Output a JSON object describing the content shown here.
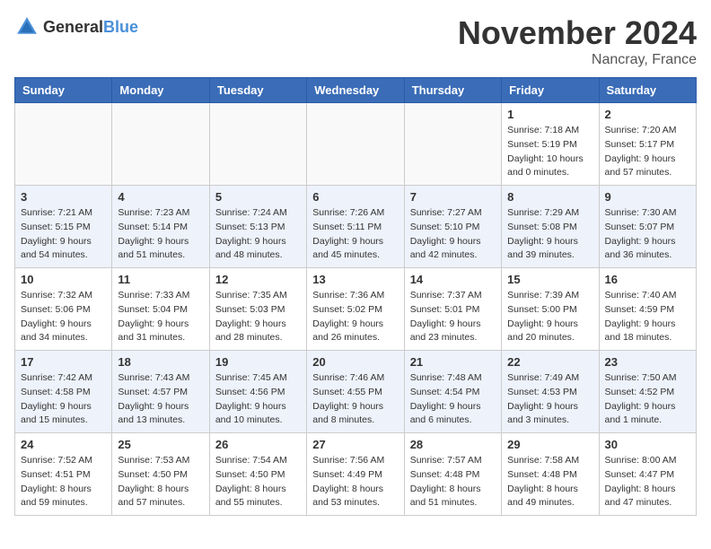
{
  "header": {
    "logo_general": "General",
    "logo_blue": "Blue",
    "month": "November 2024",
    "location": "Nancray, France"
  },
  "weekdays": [
    "Sunday",
    "Monday",
    "Tuesday",
    "Wednesday",
    "Thursday",
    "Friday",
    "Saturday"
  ],
  "weeks": [
    [
      {
        "day": "",
        "info": ""
      },
      {
        "day": "",
        "info": ""
      },
      {
        "day": "",
        "info": ""
      },
      {
        "day": "",
        "info": ""
      },
      {
        "day": "",
        "info": ""
      },
      {
        "day": "1",
        "info": "Sunrise: 7:18 AM\nSunset: 5:19 PM\nDaylight: 10 hours and 0 minutes."
      },
      {
        "day": "2",
        "info": "Sunrise: 7:20 AM\nSunset: 5:17 PM\nDaylight: 9 hours and 57 minutes."
      }
    ],
    [
      {
        "day": "3",
        "info": "Sunrise: 7:21 AM\nSunset: 5:15 PM\nDaylight: 9 hours and 54 minutes."
      },
      {
        "day": "4",
        "info": "Sunrise: 7:23 AM\nSunset: 5:14 PM\nDaylight: 9 hours and 51 minutes."
      },
      {
        "day": "5",
        "info": "Sunrise: 7:24 AM\nSunset: 5:13 PM\nDaylight: 9 hours and 48 minutes."
      },
      {
        "day": "6",
        "info": "Sunrise: 7:26 AM\nSunset: 5:11 PM\nDaylight: 9 hours and 45 minutes."
      },
      {
        "day": "7",
        "info": "Sunrise: 7:27 AM\nSunset: 5:10 PM\nDaylight: 9 hours and 42 minutes."
      },
      {
        "day": "8",
        "info": "Sunrise: 7:29 AM\nSunset: 5:08 PM\nDaylight: 9 hours and 39 minutes."
      },
      {
        "day": "9",
        "info": "Sunrise: 7:30 AM\nSunset: 5:07 PM\nDaylight: 9 hours and 36 minutes."
      }
    ],
    [
      {
        "day": "10",
        "info": "Sunrise: 7:32 AM\nSunset: 5:06 PM\nDaylight: 9 hours and 34 minutes."
      },
      {
        "day": "11",
        "info": "Sunrise: 7:33 AM\nSunset: 5:04 PM\nDaylight: 9 hours and 31 minutes."
      },
      {
        "day": "12",
        "info": "Sunrise: 7:35 AM\nSunset: 5:03 PM\nDaylight: 9 hours and 28 minutes."
      },
      {
        "day": "13",
        "info": "Sunrise: 7:36 AM\nSunset: 5:02 PM\nDaylight: 9 hours and 26 minutes."
      },
      {
        "day": "14",
        "info": "Sunrise: 7:37 AM\nSunset: 5:01 PM\nDaylight: 9 hours and 23 minutes."
      },
      {
        "day": "15",
        "info": "Sunrise: 7:39 AM\nSunset: 5:00 PM\nDaylight: 9 hours and 20 minutes."
      },
      {
        "day": "16",
        "info": "Sunrise: 7:40 AM\nSunset: 4:59 PM\nDaylight: 9 hours and 18 minutes."
      }
    ],
    [
      {
        "day": "17",
        "info": "Sunrise: 7:42 AM\nSunset: 4:58 PM\nDaylight: 9 hours and 15 minutes."
      },
      {
        "day": "18",
        "info": "Sunrise: 7:43 AM\nSunset: 4:57 PM\nDaylight: 9 hours and 13 minutes."
      },
      {
        "day": "19",
        "info": "Sunrise: 7:45 AM\nSunset: 4:56 PM\nDaylight: 9 hours and 10 minutes."
      },
      {
        "day": "20",
        "info": "Sunrise: 7:46 AM\nSunset: 4:55 PM\nDaylight: 9 hours and 8 minutes."
      },
      {
        "day": "21",
        "info": "Sunrise: 7:48 AM\nSunset: 4:54 PM\nDaylight: 9 hours and 6 minutes."
      },
      {
        "day": "22",
        "info": "Sunrise: 7:49 AM\nSunset: 4:53 PM\nDaylight: 9 hours and 3 minutes."
      },
      {
        "day": "23",
        "info": "Sunrise: 7:50 AM\nSunset: 4:52 PM\nDaylight: 9 hours and 1 minute."
      }
    ],
    [
      {
        "day": "24",
        "info": "Sunrise: 7:52 AM\nSunset: 4:51 PM\nDaylight: 8 hours and 59 minutes."
      },
      {
        "day": "25",
        "info": "Sunrise: 7:53 AM\nSunset: 4:50 PM\nDaylight: 8 hours and 57 minutes."
      },
      {
        "day": "26",
        "info": "Sunrise: 7:54 AM\nSunset: 4:50 PM\nDaylight: 8 hours and 55 minutes."
      },
      {
        "day": "27",
        "info": "Sunrise: 7:56 AM\nSunset: 4:49 PM\nDaylight: 8 hours and 53 minutes."
      },
      {
        "day": "28",
        "info": "Sunrise: 7:57 AM\nSunset: 4:48 PM\nDaylight: 8 hours and 51 minutes."
      },
      {
        "day": "29",
        "info": "Sunrise: 7:58 AM\nSunset: 4:48 PM\nDaylight: 8 hours and 49 minutes."
      },
      {
        "day": "30",
        "info": "Sunrise: 8:00 AM\nSunset: 4:47 PM\nDaylight: 8 hours and 47 minutes."
      }
    ]
  ]
}
